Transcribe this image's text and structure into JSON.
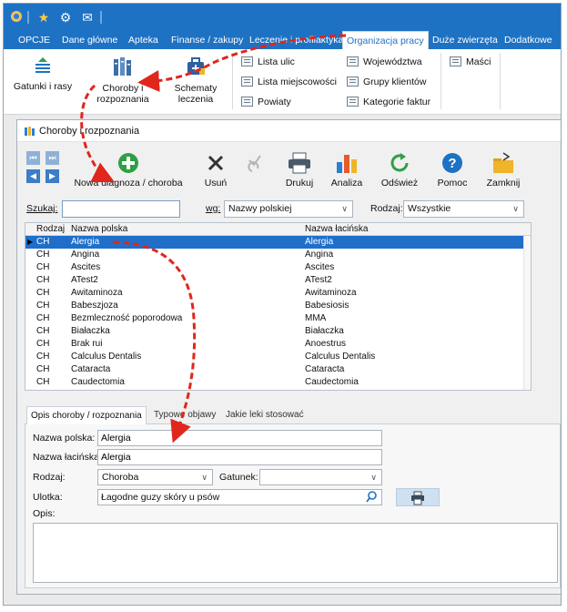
{
  "ribbon_tabs": [
    "OPCJE",
    "Dane główne",
    "Apteka",
    "Finanse / zakupy",
    "Leczenie i profilaktyka",
    "Organizacja pracy",
    "Duże zwierzęta",
    "Dodatkowe"
  ],
  "ribbon": {
    "big_buttons": [
      "Gatunki i rasy",
      "Choroby i rozpoznania",
      "Schematy leczenia"
    ],
    "col1": [
      "Lista ulic",
      "Lista miejscowości",
      "Powiaty"
    ],
    "col2": [
      "Województwa",
      "Grupy klientów",
      "Kategorie faktur"
    ],
    "col3": [
      "Maści"
    ]
  },
  "window": {
    "title": "Choroby i rozpoznania",
    "toolbar": {
      "new": "Nowa diagnoza / choroba",
      "delete": "Usuń",
      "print": "Drukuj",
      "analysis": "Analiza",
      "refresh": "Odśwież",
      "help": "Pomoc",
      "close": "Zamknij"
    },
    "search": {
      "label": "Szukaj:",
      "value": "",
      "by_label": "wg:",
      "by_value": "Nazwy polskiej",
      "kind_label": "Rodzaj:",
      "kind_value": "Wszystkie"
    },
    "grid": {
      "headers": [
        "Rodzaj",
        "Nazwa polska",
        "Nazwa łacińska"
      ],
      "rows": [
        [
          "CH",
          "Alergia",
          "Alergia"
        ],
        [
          "CH",
          "Angina",
          "Angina"
        ],
        [
          "CH",
          "Ascites",
          "Ascites"
        ],
        [
          "CH",
          "ATest2",
          "ATest2"
        ],
        [
          "CH",
          "Awitaminoza",
          "Awitaminoza"
        ],
        [
          "CH",
          "Babeszjoza",
          "Babesiosis"
        ],
        [
          "CH",
          "Bezmleczność poporodowa",
          "MMA"
        ],
        [
          "CH",
          "Białaczka",
          "Białaczka"
        ],
        [
          "CH",
          "Brak rui",
          "Anoestrus"
        ],
        [
          "CH",
          "Calculus Dentalis",
          "Calculus Dentalis"
        ],
        [
          "CH",
          "Cataracta",
          "Cataracta"
        ],
        [
          "CH",
          "Caudectomia",
          "Caudectomia"
        ]
      ]
    },
    "detail_tabs": [
      "Opis choroby / rozpoznania",
      "Typowe objawy",
      "Jakie leki stosować"
    ],
    "form": {
      "polish_label": "Nazwa polska:",
      "polish_value": "Alergia",
      "latin_label": "Nazwa łacińska:",
      "latin_value": "Alergia",
      "kind_label": "Rodzaj:",
      "kind_value": "Choroba",
      "species_label": "Gatunek:",
      "species_value": "",
      "leaflet_label": "Ulotka:",
      "leaflet_value": "Łagodne guzy skóry u psów",
      "desc_label": "Opis:"
    }
  },
  "colors": {
    "accent": "#1e72c4",
    "selection": "#1f6fca",
    "arrow": "#e0261d"
  }
}
